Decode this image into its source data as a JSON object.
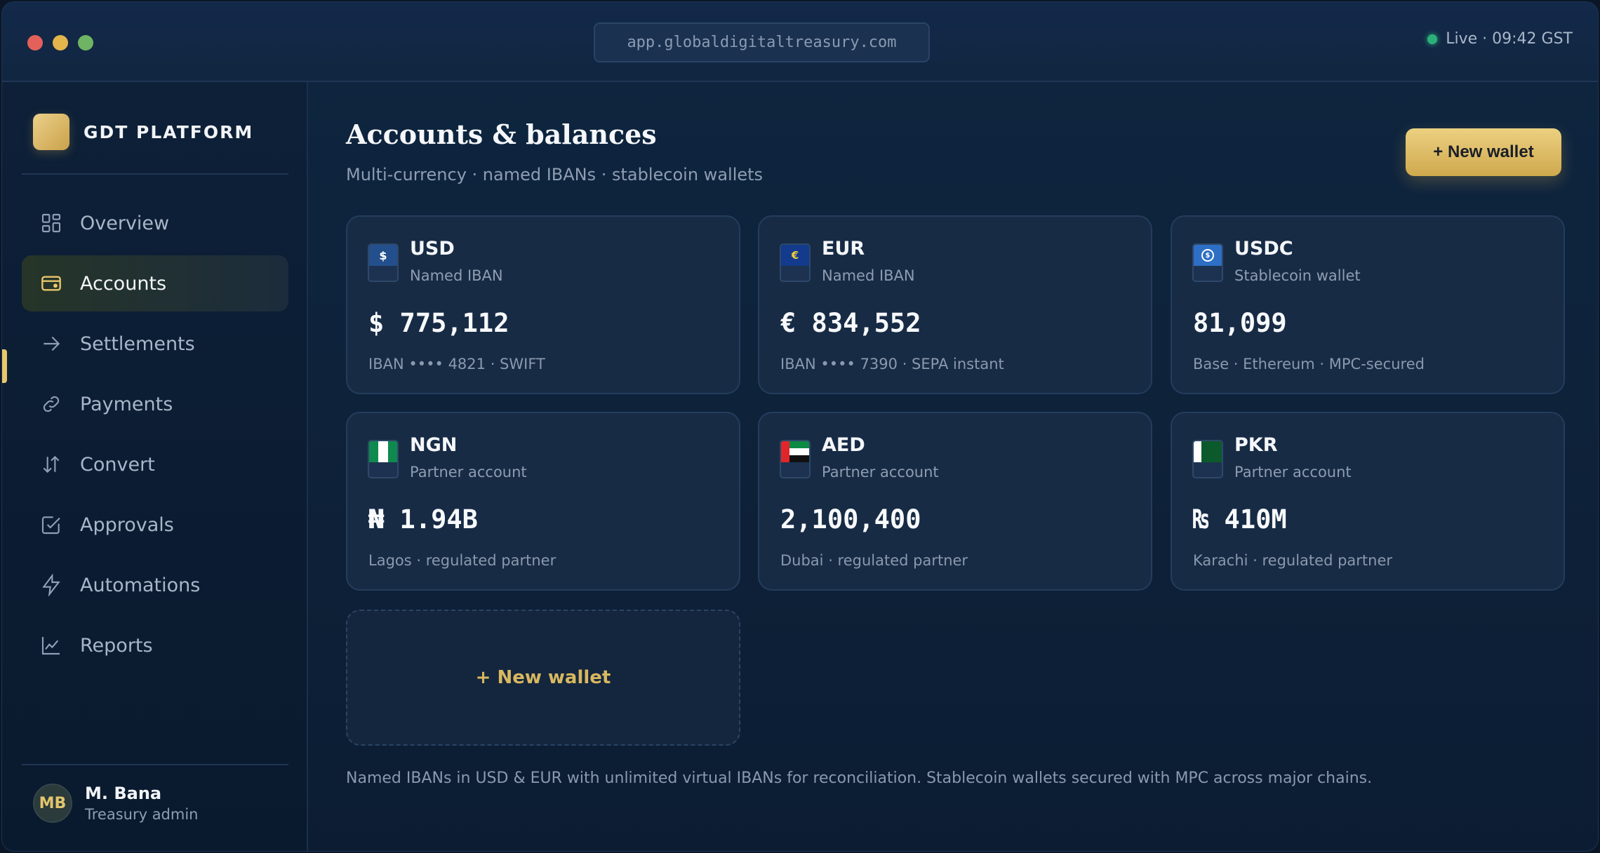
{
  "window": {
    "url": "app.globaldigitaltreasury.com",
    "status": "Live · 09:42 GST",
    "colors": {
      "accent": "#e8c66c",
      "live": "#2bb07a"
    }
  },
  "sidebar": {
    "brand": "GDT PLATFORM",
    "items": [
      {
        "label": "Overview",
        "icon": "grid-icon"
      },
      {
        "label": "Accounts",
        "icon": "wallet-icon",
        "active": true
      },
      {
        "label": "Settlements",
        "icon": "arrow-right-icon"
      },
      {
        "label": "Payments",
        "icon": "link-icon"
      },
      {
        "label": "Convert",
        "icon": "swap-vertical-icon"
      },
      {
        "label": "Approvals",
        "icon": "checkbox-icon"
      },
      {
        "label": "Automations",
        "icon": "bolt-icon"
      },
      {
        "label": "Reports",
        "icon": "chart-line-icon"
      }
    ],
    "user": {
      "initials": "MB",
      "name": "M. Bana",
      "role": "Treasury admin"
    }
  },
  "main": {
    "title": "Accounts & balances",
    "subtitle": "Multi-currency · named IBANs · stablecoin wallets",
    "new_wallet_label": "+ New wallet",
    "accounts": [
      {
        "code": "USD",
        "type": "Named IBAN",
        "balance": "$ 775,112",
        "meta": "IBAN •••• 4821 · SWIFT",
        "flag": "usd-flag-icon",
        "flag_glyph": "$"
      },
      {
        "code": "EUR",
        "type": "Named IBAN",
        "balance": "€ 834,552",
        "meta": "IBAN •••• 7390 · SEPA instant",
        "flag": "eu-flag-icon",
        "flag_glyph": "€"
      },
      {
        "code": "USDC",
        "type": "Stablecoin wallet",
        "balance": "81,099",
        "meta": "Base · Ethereum · MPC-secured",
        "flag": "usdc-coin-icon",
        "flag_glyph": "$"
      },
      {
        "code": "NGN",
        "type": "Partner account",
        "balance": "₦ 1.94B",
        "meta": "Lagos · regulated partner",
        "flag": "nigeria-flag-icon"
      },
      {
        "code": "AED",
        "type": "Partner account",
        "balance": "2,100,400",
        "meta": "Dubai · regulated partner",
        "flag": "uae-flag-icon"
      },
      {
        "code": "PKR",
        "type": "Partner account",
        "balance": "₨ 410M",
        "meta": "Karachi · regulated partner",
        "flag": "pakistan-flag-icon"
      }
    ],
    "add_wallet_label": "+ New wallet",
    "footer_note": "Named IBANs in USD & EUR with unlimited virtual IBANs for reconciliation. Stablecoin wallets secured with MPC across major chains."
  }
}
